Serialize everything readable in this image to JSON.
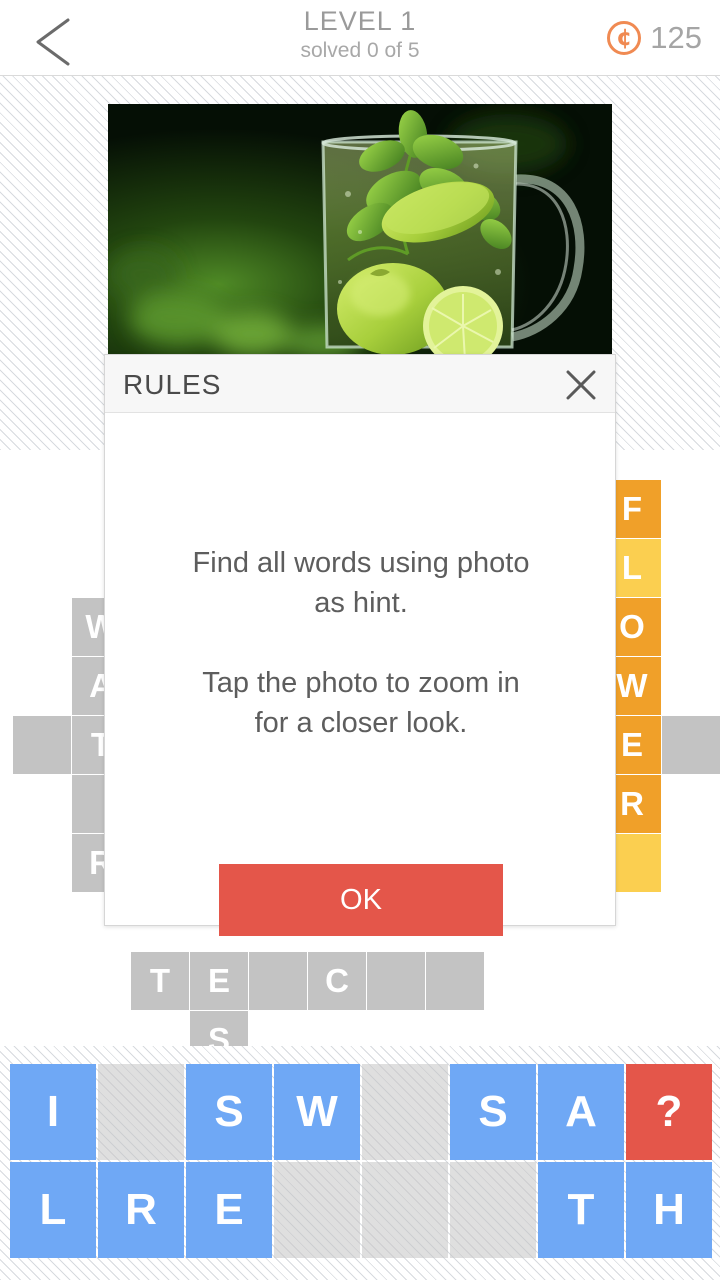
{
  "header": {
    "back_icon": "chevron-left-icon",
    "level_title": "LEVEL 1",
    "level_subtitle": "solved 0 of 5",
    "coin_icon": "coin-icon",
    "coin_symbol": "¢",
    "coin_count": "125"
  },
  "photo": {
    "alt": "glass mug of water with lime slices and mint leaves",
    "colors": {
      "background_dark": "#06150a",
      "foliage": "#3f7a1e",
      "lime": "#b9d94a",
      "glass": "#cfe7d2"
    }
  },
  "modal": {
    "title": "RULES",
    "close_icon": "close-icon",
    "body_text": "Find all words using photo\nas hint.\n\nTap the photo to zoom in\nfor a closer look.",
    "ok_label": "OK",
    "ok_color": "#e4564a"
  },
  "colors": {
    "cell_empty": "#c3c3c3",
    "cell_solved": "#f0a029",
    "cell_solved_light": "#fbcf50",
    "key_available": "#6fa8f5",
    "key_hint": "#e4564a",
    "accent_orange": "#f08a52"
  },
  "board": {
    "cell_size": 58,
    "cells": [
      {
        "col": 0,
        "row": 4,
        "letter": "",
        "state": "empty"
      },
      {
        "col": 1,
        "row": 2,
        "letter": "W",
        "state": "empty"
      },
      {
        "col": 1,
        "row": 3,
        "letter": "A",
        "state": "empty"
      },
      {
        "col": 1,
        "row": 4,
        "letter": "T",
        "state": "empty"
      },
      {
        "col": 1,
        "row": 5,
        "letter": "",
        "state": "empty"
      },
      {
        "col": 1,
        "row": 6,
        "letter": "R",
        "state": "empty"
      },
      {
        "col": 10,
        "row": 0,
        "letter": "F",
        "state": "solved"
      },
      {
        "col": 10,
        "row": 1,
        "letter": "L",
        "state": "solved-light"
      },
      {
        "col": 10,
        "row": 2,
        "letter": "O",
        "state": "solved"
      },
      {
        "col": 10,
        "row": 3,
        "letter": "W",
        "state": "solved"
      },
      {
        "col": 10,
        "row": 4,
        "letter": "E",
        "state": "solved"
      },
      {
        "col": 10,
        "row": 5,
        "letter": "R",
        "state": "solved"
      },
      {
        "col": 10,
        "row": 6,
        "letter": "",
        "state": "solved-light"
      },
      {
        "col": 11,
        "row": 4,
        "letter": "",
        "state": "empty"
      },
      {
        "col": 2,
        "row": 8,
        "letter": "T",
        "state": "empty"
      },
      {
        "col": 3,
        "row": 8,
        "letter": "E",
        "state": "empty"
      },
      {
        "col": 4,
        "row": 8,
        "letter": "",
        "state": "empty"
      },
      {
        "col": 5,
        "row": 8,
        "letter": "C",
        "state": "empty"
      },
      {
        "col": 6,
        "row": 8,
        "letter": "",
        "state": "empty"
      },
      {
        "col": 7,
        "row": 8,
        "letter": "",
        "state": "empty"
      },
      {
        "col": 3,
        "row": 9,
        "letter": "S",
        "state": "empty"
      }
    ]
  },
  "keyboard": {
    "rows": [
      [
        {
          "letter": "I",
          "state": "available"
        },
        {
          "letter": "",
          "state": "used"
        },
        {
          "letter": "S",
          "state": "available"
        },
        {
          "letter": "W",
          "state": "available"
        },
        {
          "letter": "",
          "state": "used"
        },
        {
          "letter": "S",
          "state": "available"
        },
        {
          "letter": "A",
          "state": "available"
        },
        {
          "letter": "?",
          "state": "hint"
        }
      ],
      [
        {
          "letter": "L",
          "state": "available"
        },
        {
          "letter": "R",
          "state": "available"
        },
        {
          "letter": "E",
          "state": "available"
        },
        {
          "letter": "",
          "state": "used"
        },
        {
          "letter": "",
          "state": "used"
        },
        {
          "letter": "",
          "state": "used"
        },
        {
          "letter": "T",
          "state": "available"
        },
        {
          "letter": "H",
          "state": "available"
        }
      ]
    ]
  }
}
